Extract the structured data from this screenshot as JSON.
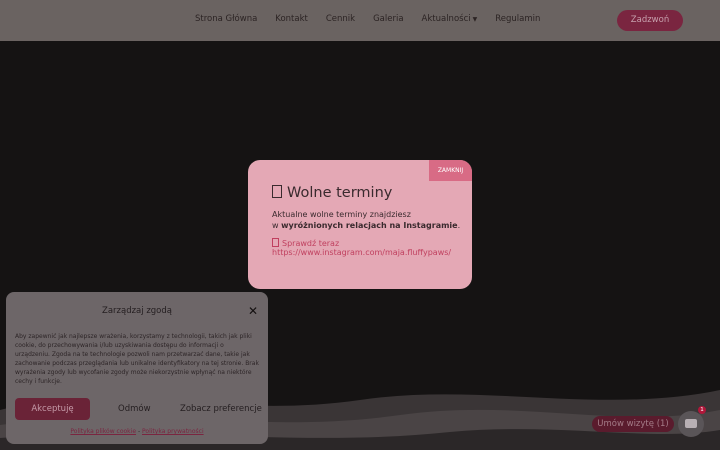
{
  "header": {
    "nav": [
      "Strona Główna",
      "Kontakt",
      "Cennik",
      "Galeria",
      "Aktualności",
      "Regulamin"
    ],
    "call_label": "Zadzwoń"
  },
  "popup": {
    "close_label": "ZAMKNIJ",
    "title": "Wolne terminy",
    "line1": "Aktualne wolne terminy znajdziesz",
    "line2_prefix": "w ",
    "line2_bold": "wyróżnionych relacjach na Instagramie",
    "line2_suffix": ".",
    "check_label": "Sprawdź teraz",
    "instagram_url": "https://www.instagram.com/maja.fluffypaws/"
  },
  "cookie": {
    "title": "Zarządzaj zgodą",
    "text": "Aby zapewnić jak najlepsze wrażenia, korzystamy z technologii, takich jak pliki cookie, do przechowywania i/lub uzyskiwania dostępu do informacji o urządzeniu. Zgoda na te technologie pozwoli nam przetwarzać dane, takie jak zachowanie podczas przeglądania lub unikalne identyfikatory na tej stronie. Brak wyrażenia zgody lub wycofanie zgody może niekorzystnie wpłynąć na niektóre cechy i funkcje.",
    "accept_label": "Akceptuję",
    "deny_label": "Odmów",
    "prefs_label": "Zobacz preferencje",
    "cookie_policy": "Polityka plików cookie",
    "separator": " - ",
    "privacy_policy": "Polityka prywatności"
  },
  "visit_label": "Umów wizytę (1)",
  "chat_badge": "1",
  "colors": {
    "accent": "#d86b85",
    "popup_bg": "#e4a8b5",
    "brand_dark": "#7a2540"
  }
}
